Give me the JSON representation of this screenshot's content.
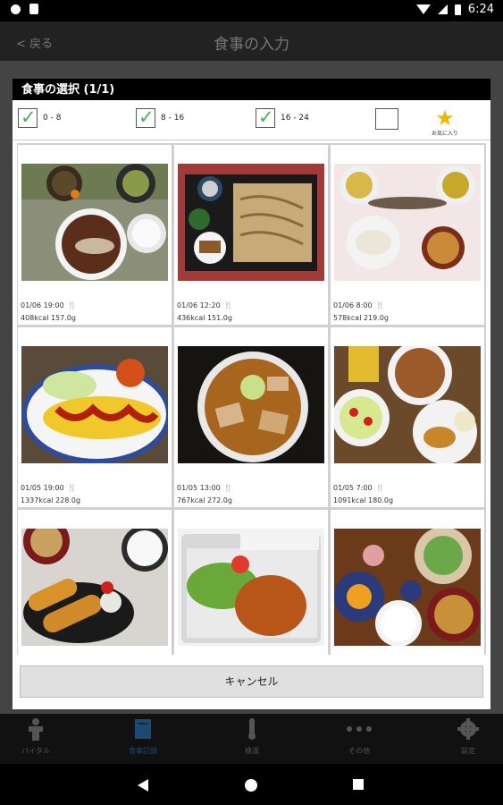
{
  "status_bar": {
    "time": "6:24"
  },
  "app_bar": {
    "back_label": "< 戻る",
    "title": "食事の入力"
  },
  "dialog": {
    "title": "食事の選択 (1/1)",
    "filters": [
      {
        "label": "0 - 8",
        "checked": true
      },
      {
        "label": "8 - 16",
        "checked": true
      },
      {
        "label": "16 - 24",
        "checked": true
      },
      {
        "label": "",
        "checked": false
      }
    ],
    "favorite_label": "お気に入り",
    "meals": [
      {
        "time": "01/06 19:00",
        "info": "408kcal  157.0g",
        "photo": "salmon set meal"
      },
      {
        "time": "01/06 12:20",
        "info": "436kcal  151.0g",
        "photo": "soba noodle set"
      },
      {
        "time": "01/06 8:00",
        "info": "578kcal  219.0g",
        "photo": "grilled fish tray"
      },
      {
        "time": "01/05 19:00",
        "info": "1337kcal  228.0g",
        "photo": "omurice"
      },
      {
        "time": "01/05 13:00",
        "info": "767kcal  272.0g",
        "photo": "ramen"
      },
      {
        "time": "01/05 7:00",
        "info": "1091kcal  180.0g",
        "photo": "buffet breakfast"
      },
      {
        "time": "",
        "info": "",
        "photo": "fried shrimp set"
      },
      {
        "time": "",
        "info": "",
        "photo": "bento box"
      },
      {
        "time": "",
        "info": "",
        "photo": "japanese breakfast"
      }
    ],
    "cancel_label": "キャンセル"
  },
  "bottom_tabs": [
    "バイタル",
    "食事記録",
    "検温",
    "その他",
    "設定"
  ],
  "icons": [
    "check-icon",
    "star-icon",
    "fork-icon",
    "back-icon",
    "home-icon",
    "recents-icon"
  ],
  "colors": {
    "check": "#4caf50",
    "star": "#f2b600",
    "fork": "#1e88e5"
  }
}
